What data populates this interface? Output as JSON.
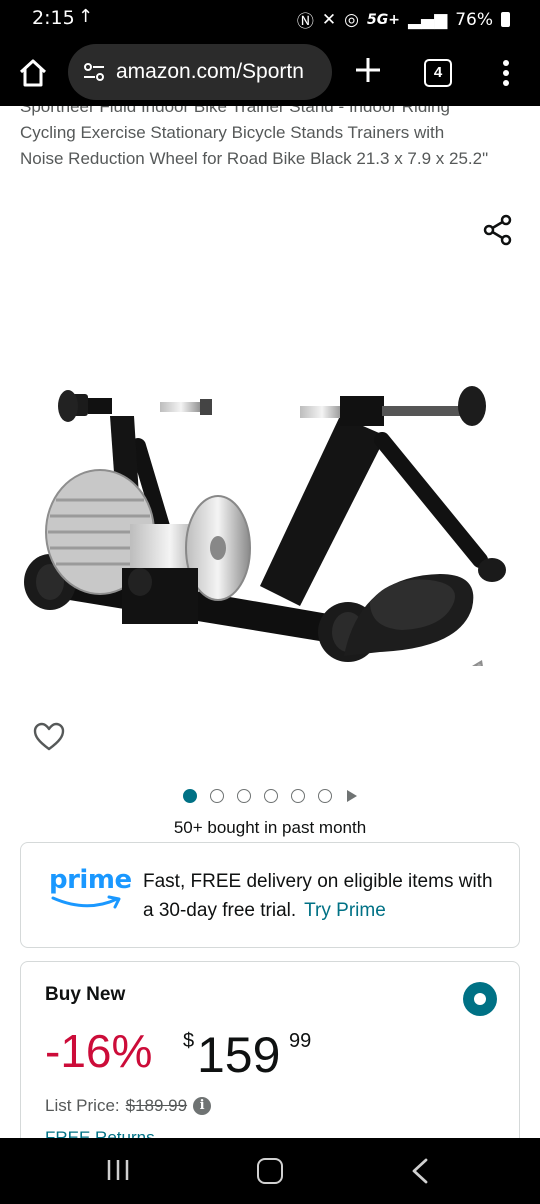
{
  "status_bar": {
    "time": "2:15",
    "network": "5G+",
    "battery": "76%"
  },
  "browser": {
    "url": "amazon.com/Sportn",
    "tab_count": "4"
  },
  "product": {
    "title_visible": "Sportneer Fluid Indoor Bike Trainer Stand - Indoor Riding Cycling Exercise Stationary Bicycle Stands Trainers with Noise Reduction Wheel for Road Bike Black 21.3 x 7.9 x 25.2\"",
    "image_count": 6,
    "active_image": 1,
    "social_proof": "50+ bought in past month"
  },
  "prime": {
    "logo_text": "prime",
    "message": "Fast, FREE delivery on eligible items with a 30-day free trial.",
    "cta": "Try Prime",
    "brand_color": "#1a98ff"
  },
  "buy_box": {
    "title": "Buy New",
    "discount": "-16%",
    "price_symbol": "$",
    "price_whole": "159",
    "price_fraction": "99",
    "list_price_label": "List Price:",
    "list_price": "$189.99",
    "returns": "FREE Returns",
    "discount_color": "#cc0c39",
    "accent_color": "#007185"
  }
}
